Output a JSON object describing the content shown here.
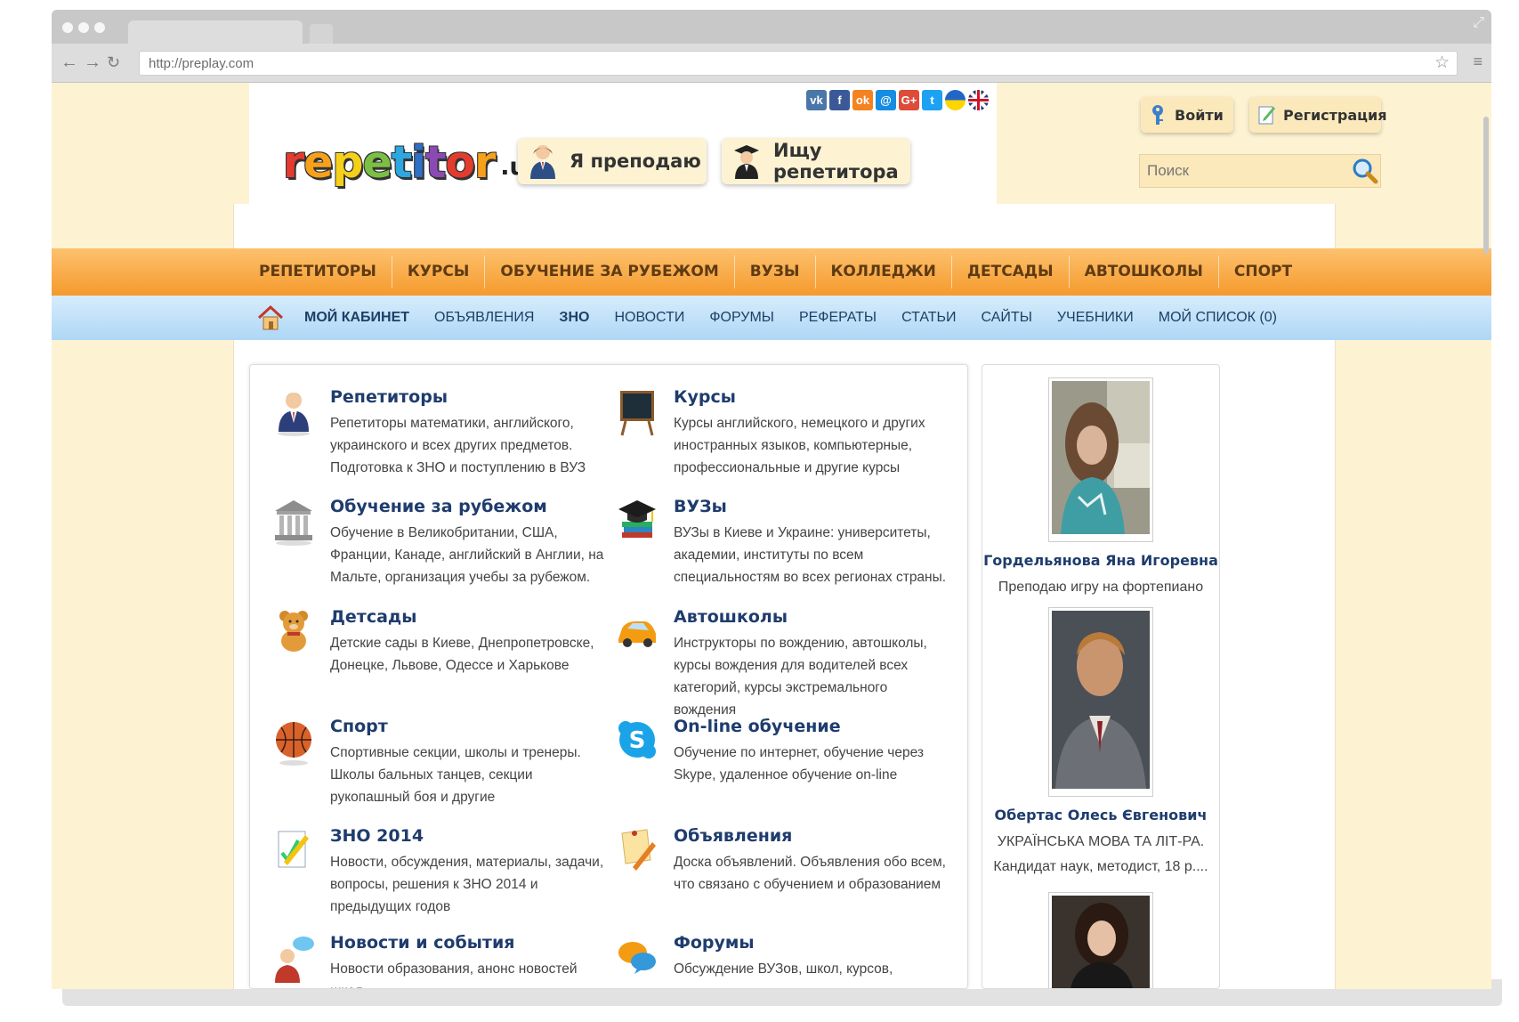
{
  "browser": {
    "url": "http://preplay.com"
  },
  "header": {
    "logo_word": "repetitor",
    "logo_tld": ".ua",
    "teach_button": "Я преподаю",
    "find_button": "Ищу репетитора",
    "login_button": "Войти",
    "register_button": "Регистрация",
    "search_placeholder": "Поиск",
    "social": [
      {
        "icon": "vk-icon",
        "glyph": "vk",
        "color": "#4a76a8"
      },
      {
        "icon": "facebook-icon",
        "glyph": "f",
        "color": "#3b5998"
      },
      {
        "icon": "odnoklassniki-icon",
        "glyph": "ok",
        "color": "#f58220"
      },
      {
        "icon": "moimir-icon",
        "glyph": "@",
        "color": "#168de2"
      },
      {
        "icon": "google-plus-icon",
        "glyph": "G+",
        "color": "#dd4b39"
      },
      {
        "icon": "twitter-icon",
        "glyph": "t",
        "color": "#1da1f2"
      },
      {
        "icon": "ukraine-flag-icon",
        "glyph": "",
        "color": "#ffd500"
      },
      {
        "icon": "uk-flag-icon",
        "glyph": "",
        "color": "#cf142b"
      }
    ]
  },
  "nav_main": [
    "РЕПЕТИТОРЫ",
    "КУРСЫ",
    "ОБУЧЕНИЕ ЗА РУБЕЖОМ",
    "ВУЗЫ",
    "КОЛЛЕДЖИ",
    "ДЕТСАДЫ",
    "АВТОШКОЛЫ",
    "СПОРТ"
  ],
  "nav_sub": [
    {
      "label": "МОЙ КАБИНЕТ",
      "bold": true
    },
    {
      "label": "ОБЪЯВЛЕНИЯ",
      "bold": false
    },
    {
      "label": "ЗНО",
      "bold": true
    },
    {
      "label": "НОВОСТИ",
      "bold": false
    },
    {
      "label": "ФОРУМЫ",
      "bold": false
    },
    {
      "label": "РЕФЕРАТЫ",
      "bold": false
    },
    {
      "label": "СТАТЬИ",
      "bold": false
    },
    {
      "label": "САЙТЫ",
      "bold": false
    },
    {
      "label": "УЧЕБНИКИ",
      "bold": false
    },
    {
      "label": "МОЙ СПИСОК (0)",
      "bold": false
    }
  ],
  "categories": [
    {
      "title": "Репетиторы",
      "icon": "tutor-person-icon",
      "desc": "Репетиторы математики, английского, украинского и всех других предметов. Подготовка к ЗНО и поступлению в ВУЗ"
    },
    {
      "title": "Курсы",
      "icon": "chalkboard-icon",
      "desc": "Курсы английского, немецкого и других иностранных языков, компьютерные, профессиональные и другие курсы"
    },
    {
      "title": "Обучение за рубежом",
      "icon": "university-building-icon",
      "desc": "Обучение в Великобритании, США, Франции, Канаде, английский в Англии, на Мальте, организация учебы за рубежом."
    },
    {
      "title": "ВУЗы",
      "icon": "graduation-cap-books-icon",
      "desc": "ВУЗы в Киеве и Украине: университеты, академии, институты по всем специальностям во всех регионах страны."
    },
    {
      "title": "Детсады",
      "icon": "teddy-bear-icon",
      "desc": "Детские сады в Киеве, Днепропетровске, Донецке, Львове, Одессе и Харькове"
    },
    {
      "title": "Автошколы",
      "icon": "car-icon",
      "desc": "Инструкторы по вождению, автошколы, курсы вождения для водителей всех категорий, курсы экстремального вождения"
    },
    {
      "title": "Спорт",
      "icon": "basketball-icon",
      "desc": "Спортивные секции, школы и тренеры. Школы бальных танцев, секции рукопашный боя и другие"
    },
    {
      "title": "On-line обучение",
      "icon": "skype-icon",
      "desc": "Обучение по интернет, обучение через Skype, удаленное обучение on-line"
    },
    {
      "title": "ЗНО 2014",
      "icon": "test-sheet-icon",
      "desc": "Новости, обсуждения, материалы, задачи, вопросы, решения к ЗНО 2014 и предыдущих годов"
    },
    {
      "title": "Объявления",
      "icon": "note-pencil-icon",
      "desc": "Доска объявлений. Объявления обо всем, что связано с обучением и образованием"
    },
    {
      "title": "Новости и события",
      "icon": "news-person-icon",
      "desc": "Новости образования, анонс новостей школ"
    },
    {
      "title": "Форумы",
      "icon": "chat-bubbles-icon",
      "desc": "Обсуждение ВУЗов, школ, курсов,"
    }
  ],
  "tutors": [
    {
      "name": "Гордельянова Яна Игоревна",
      "line1": "Преподаю игру на фортепиано",
      "line2": ""
    },
    {
      "name": "Обертас Олесь Євгенович",
      "line1": "УКРАЇНСЬКА МОВА ТА ЛІТ-РА.",
      "line2": "Кандидат наук, методист, 18 р...."
    },
    {
      "name": "",
      "line1": "",
      "line2": ""
    }
  ],
  "colors": {
    "orange_nav": "#f59a2c",
    "blue_nav": "#aed7f6",
    "page_bg": "#fdf3d3",
    "title_blue": "#1f3c6d"
  }
}
